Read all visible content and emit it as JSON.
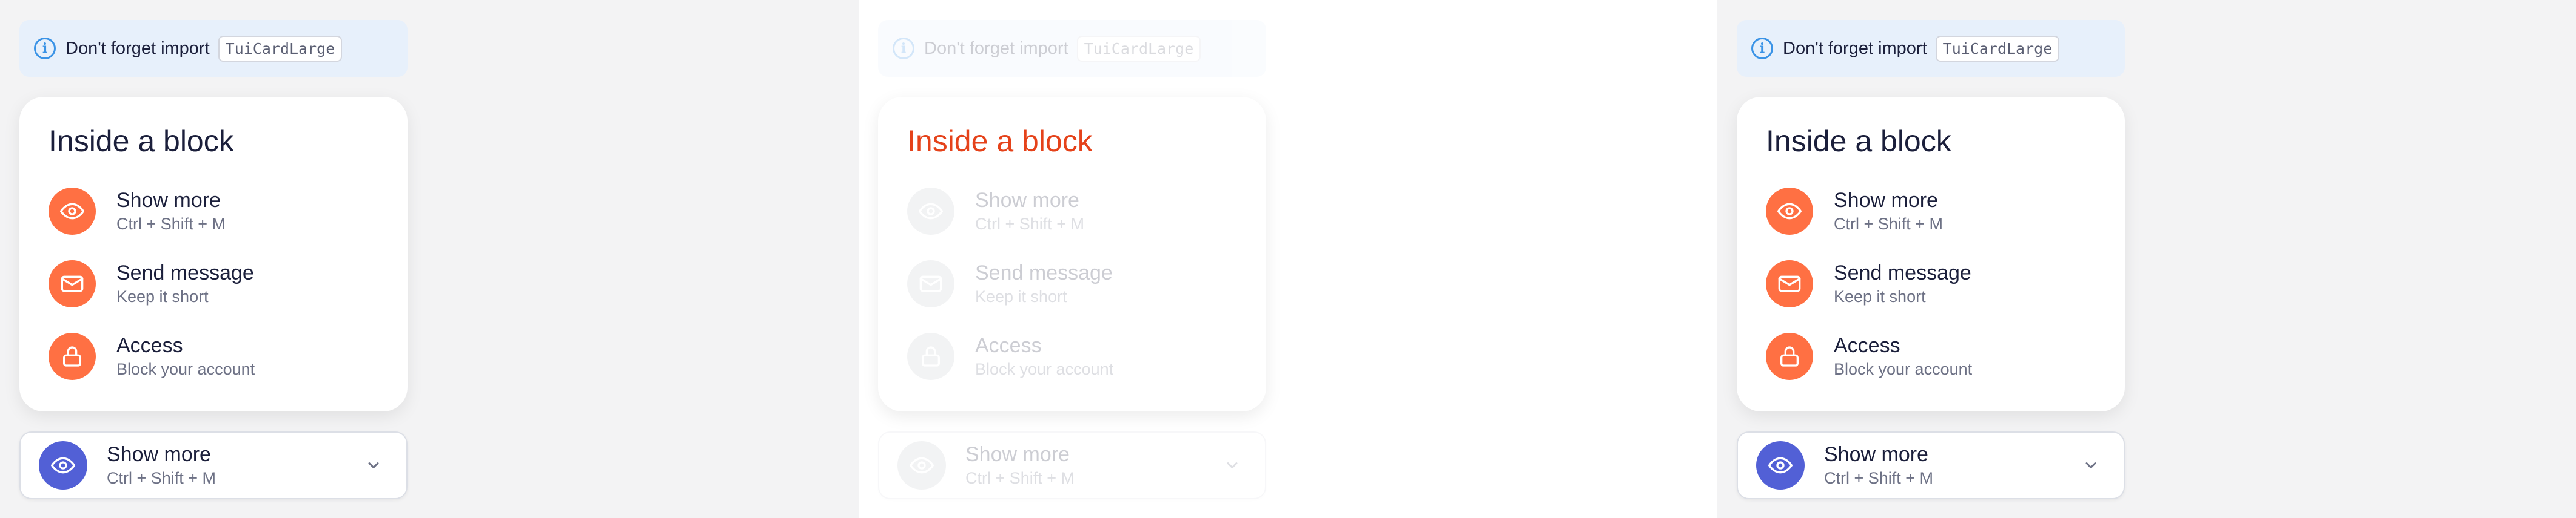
{
  "notice": {
    "text": "Don't forget import",
    "code": "TuiCardLarge"
  },
  "card": {
    "title": "Inside a block",
    "items": [
      {
        "title": "Show more",
        "subtitle": "Ctrl + Shift + M",
        "icon": "eye-icon"
      },
      {
        "title": "Send message",
        "subtitle": "Keep it short",
        "icon": "mail-icon"
      },
      {
        "title": "Access",
        "subtitle": "Block your account",
        "icon": "lock-icon"
      }
    ]
  },
  "select": {
    "title": "Show more",
    "subtitle": "Ctrl + Shift + M",
    "icon": "eye-icon"
  },
  "colors": {
    "accent_orange": "#ff7043",
    "accent_blue": "#5260d6",
    "title_highlight": "#e5421a",
    "info_blue": "#3a93e6"
  }
}
